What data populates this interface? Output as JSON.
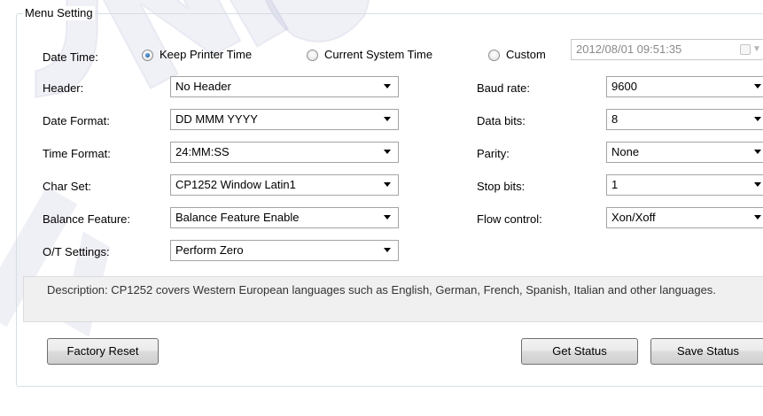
{
  "group_title": "Menu Setting",
  "date_time": {
    "label": "Date Time:",
    "options": [
      "Keep Printer Time",
      "Current System Time",
      "Custom"
    ],
    "selected": "Keep Printer Time",
    "custom_value": "2012/08/01 09:51:35"
  },
  "left_fields": [
    {
      "label": "Header:",
      "value": "No Header"
    },
    {
      "label": "Date Format:",
      "value": "DD MMM YYYY"
    },
    {
      "label": "Time Format:",
      "value": "24:MM:SS"
    },
    {
      "label": "Char Set:",
      "value": "CP1252 Window Latin1"
    },
    {
      "label": "Balance Feature:",
      "value": "Balance Feature Enable"
    },
    {
      "label": "O/T Settings:",
      "value": "Perform Zero"
    }
  ],
  "right_fields": [
    {
      "label": "Baud rate:",
      "value": "9600"
    },
    {
      "label": "Data bits:",
      "value": "8"
    },
    {
      "label": "Parity:",
      "value": "None"
    },
    {
      "label": "Stop bits:",
      "value": "1"
    },
    {
      "label": "Flow control:",
      "value": "Xon/Xoff"
    }
  ],
  "description": "Description: CP1252 covers Western European languages such as English, German, French, Spanish, Italian and other languages.",
  "buttons": {
    "factory_reset": "Factory Reset",
    "get_status": "Get Status",
    "save_status": "Save Status"
  },
  "colors": {
    "group_border": "#d5dfe5",
    "description_bg": "#f0f0f0",
    "radio_selected": "#1e5f9d",
    "watermark": "#2d2d8f"
  }
}
